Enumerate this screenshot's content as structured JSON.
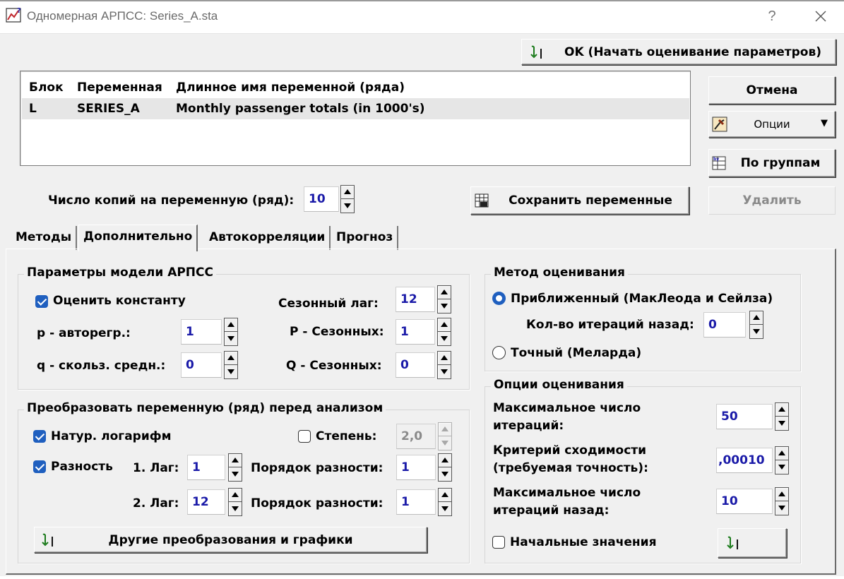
{
  "window": {
    "title": "Одномерная АРПСС: Series_A.sta",
    "help": "?"
  },
  "buttons": {
    "ok": "OK (Начать оценивание параметров)",
    "cancel": "Отмена",
    "options": "Опции",
    "by_groups": "По группам",
    "save_vars": "Сохранить переменные",
    "delete": "Удалить",
    "other_transforms": "Другие преобразования и графики"
  },
  "var_list": {
    "headers": [
      "Блок",
      "Переменная",
      "Длинное имя переменной (ряда)"
    ],
    "rows": [
      [
        "L",
        "SERIES_A",
        "Monthly passenger totals (in 1000's)"
      ]
    ]
  },
  "copies": {
    "label": "Число копий на переменную (ряд):",
    "value": "10"
  },
  "tabs": [
    "Методы",
    "Дополнительно",
    "Автокорреляции",
    "Прогноз"
  ],
  "active_tab": "Дополнительно",
  "arima_params": {
    "title": "Параметры модели АРПСС",
    "estimate_constant": "Оценить константу",
    "estimate_constant_checked": true,
    "p_label": "p - авторегр.:",
    "p_value": "1",
    "q_label": "q - скольз. средн.:",
    "q_value": "0",
    "seasonal_lag_label": "Сезонный лаг:",
    "seasonal_lag_value": "12",
    "P_label": "P - Сезонных:",
    "P_value": "1",
    "Q_label": "Q - Сезонных:",
    "Q_value": "0"
  },
  "transform": {
    "title": "Преобразовать переменную (ряд) перед анализом",
    "natural_log": "Натур. логарифм",
    "natural_log_checked": true,
    "power": "Степень:",
    "power_checked": false,
    "power_value": "2,0",
    "difference": "Разность",
    "difference_checked": true,
    "lag1_label": "1. Лаг:",
    "lag1_value": "1",
    "order1_label": "Порядок разности:",
    "order1_value": "1",
    "lag2_label": "2. Лаг:",
    "lag2_value": "12",
    "order2_label": "Порядок разности:",
    "order2_value": "1"
  },
  "estimation_method": {
    "title": "Метод оценивания",
    "approx": "Приближенный (МакЛеода и Сейлза)",
    "approx_selected": true,
    "backcast_label": "Кол-во итераций назад:",
    "backcast_value": "0",
    "exact": "Точный (Меларда)",
    "exact_selected": false
  },
  "estimation_options": {
    "title": "Опции оценивания",
    "max_iter_line1": "Максимальное число",
    "max_iter_line2": "итераций:",
    "max_iter_value": "50",
    "convergence_line1": "Критерий сходимости",
    "convergence_line2": "(требуемая точность):",
    "convergence_value": ",00010",
    "max_back_line1": "Максимальное число",
    "max_back_line2": "итераций назад:",
    "max_back_value": "10",
    "initial_values": "Начальные значения",
    "initial_values_checked": false
  }
}
